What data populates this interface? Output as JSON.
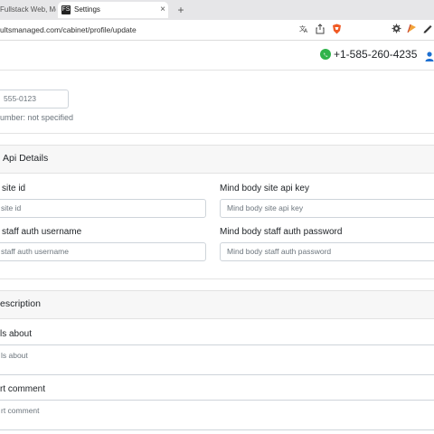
{
  "browser": {
    "tabs": [
      {
        "title": "Fullstack Web, Mob"
      },
      {
        "title": "Settings",
        "close_glyph": "×"
      }
    ],
    "new_tab_glyph": "+",
    "url": "ultsmanaged.com/cabinet/profile/update",
    "favicon_text": "FS"
  },
  "header": {
    "phone": "+1-585-260-4235"
  },
  "contact": {
    "phone_input_value": "555-0123",
    "phone_number_note": "umber: not specified"
  },
  "api_section": {
    "title": "Api Details",
    "fields": [
      {
        "label": "site id",
        "placeholder": "site id"
      },
      {
        "label": "Mind body site api key",
        "placeholder": "Mind body site api key"
      },
      {
        "label": "staff auth username",
        "placeholder": "staff auth username"
      },
      {
        "label": "Mind body staff auth password",
        "placeholder": "Mind body staff auth password"
      }
    ]
  },
  "description_section": {
    "title": "escription",
    "fields": [
      {
        "label": "ls about",
        "placeholder": "ls about"
      },
      {
        "label": "rt comment",
        "placeholder": "rt comment"
      }
    ]
  },
  "colors": {
    "whatsapp": "#2fb34a",
    "user_icon": "#1d6fd1",
    "section_bg": "#f7f7f7"
  }
}
